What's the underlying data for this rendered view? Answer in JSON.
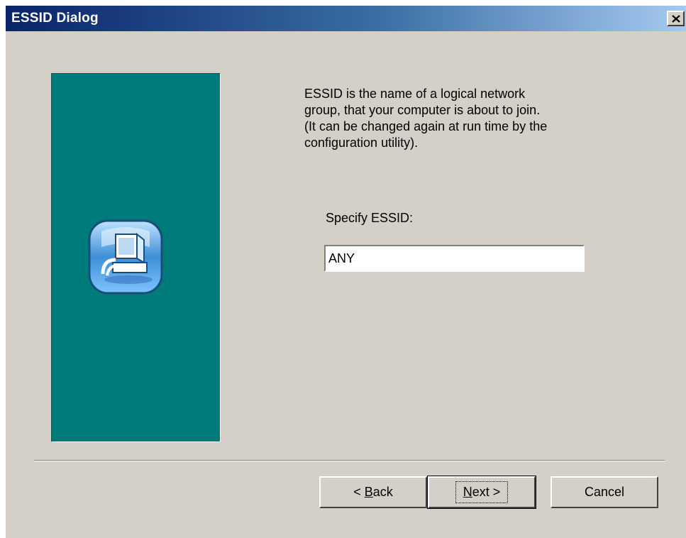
{
  "window": {
    "title": "ESSID Dialog"
  },
  "content": {
    "description": "ESSID is the name of a logical network\ngroup, that your computer is about to join.\n(It can be changed again at run time by the\nconfiguration utility).",
    "field_label": "Specify ESSID:",
    "essid_value": "ANY"
  },
  "buttons": {
    "back": {
      "prefix": "< ",
      "accel": "B",
      "rest": "ack"
    },
    "next": {
      "accel": "N",
      "rest": "ext >"
    },
    "cancel": "Cancel"
  },
  "colors": {
    "dialog_bg": "#d4d0c8",
    "side_panel": "#007b7b",
    "titlebar_start": "#0a246a",
    "titlebar_end": "#a6caf0"
  },
  "icons": {
    "panel": "network-computer-icon",
    "close": "close-icon"
  }
}
